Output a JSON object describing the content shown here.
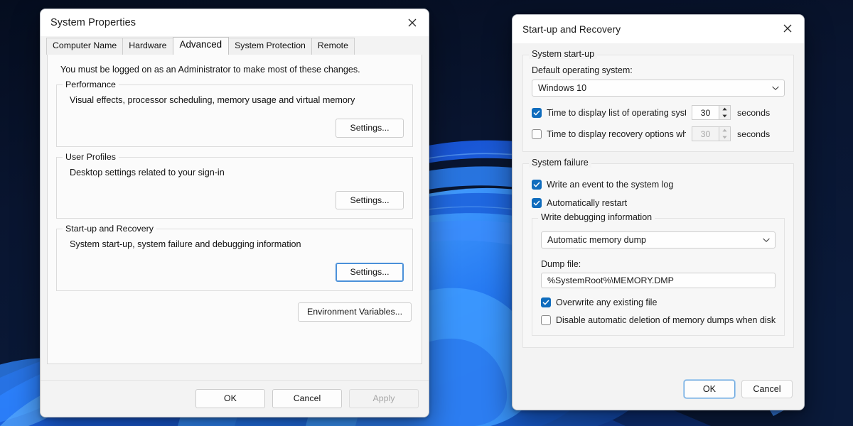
{
  "theme": {
    "accent": "#0f6cbd",
    "focus_ring": "#4a90d9",
    "wallpaper_dark": "#081228",
    "wallpaper_blue": "#1f6dea",
    "wallpaper_blue_light": "#3e9bff"
  },
  "system_properties": {
    "title": "System Properties",
    "close_icon": "close-icon",
    "tabs": [
      {
        "label": "Computer Name",
        "active": false
      },
      {
        "label": "Hardware",
        "active": false
      },
      {
        "label": "Advanced",
        "active": true
      },
      {
        "label": "System Protection",
        "active": false
      },
      {
        "label": "Remote",
        "active": false
      }
    ],
    "admin_note": "You must be logged on as an Administrator to make most of these changes.",
    "groups": [
      {
        "legend": "Performance",
        "description": "Visual effects, processor scheduling, memory usage and virtual memory",
        "button": "Settings...",
        "focused": false
      },
      {
        "legend": "User Profiles",
        "description": "Desktop settings related to your sign-in",
        "button": "Settings...",
        "focused": false
      },
      {
        "legend": "Start-up and Recovery",
        "description": "System start-up, system failure and debugging information",
        "button": "Settings...",
        "focused": true
      }
    ],
    "environment_variables_button": "Environment Variables...",
    "footer": {
      "ok": "OK",
      "cancel": "Cancel",
      "apply": "Apply",
      "apply_disabled": true
    }
  },
  "startup_recovery": {
    "title": "Start-up and Recovery",
    "close_icon": "close-icon",
    "system_startup": {
      "legend": "System start-up",
      "default_os_label": "Default operating system:",
      "default_os_value": "Windows 10",
      "dropdown_icon": "chevron-down-icon",
      "timeout_os_list": {
        "label": "Time to display list of operating systems:",
        "checked": true,
        "value": "30",
        "unit": "seconds",
        "enabled": true
      },
      "timeout_recovery": {
        "label": "Time to display recovery options when needec",
        "checked": false,
        "value": "30",
        "unit": "seconds",
        "enabled": false
      }
    },
    "system_failure": {
      "legend": "System failure",
      "write_event": {
        "label": "Write an event to the system log",
        "checked": true
      },
      "auto_restart": {
        "label": "Automatically restart",
        "checked": true
      },
      "debug_group": {
        "legend": "Write debugging information",
        "dump_type_value": "Automatic memory dump",
        "dropdown_icon": "chevron-down-icon",
        "dump_file_label": "Dump file:",
        "dump_file_value": "%SystemRoot%\\MEMORY.DMP"
      },
      "overwrite": {
        "label": "Overwrite any existing file",
        "checked": true
      },
      "disable_deletion": {
        "label": "Disable automatic deletion of memory dumps when disk space is l",
        "checked": false
      }
    },
    "footer": {
      "ok": "OK",
      "cancel": "Cancel",
      "ok_focused": true
    }
  }
}
